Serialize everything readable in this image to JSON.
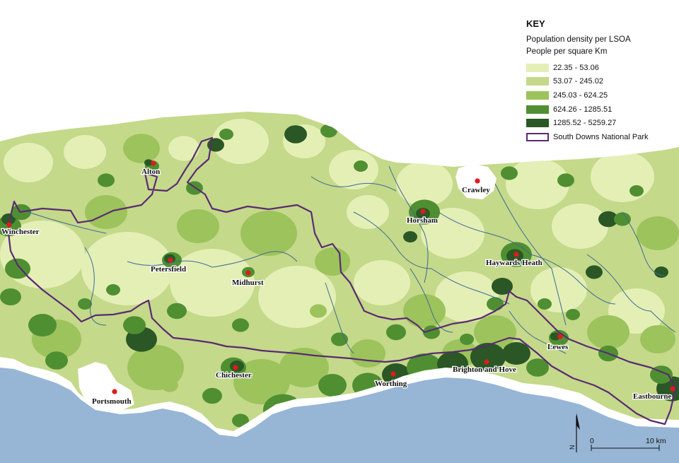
{
  "legend": {
    "title": "KEY",
    "subtitle_1": "Population density per LSOA",
    "subtitle_2": "People per square Km",
    "classes": [
      {
        "label": "22.35 - 53.06",
        "color": "#e4efb6"
      },
      {
        "label": "53.07 - 245.02",
        "color": "#c4d98a"
      },
      {
        "label": "245.03 - 624.25",
        "color": "#9dc35c"
      },
      {
        "label": "624.26 - 1285.51",
        "color": "#4f8f32"
      },
      {
        "label": "1285.52 - 5259.27",
        "color": "#2a5725"
      }
    ],
    "boundary_label": "South Downs National Park",
    "boundary_color": "#5a2a72"
  },
  "towns": [
    {
      "name": "Alton"
    },
    {
      "name": "Winchester"
    },
    {
      "name": "Petersfield"
    },
    {
      "name": "Midhurst"
    },
    {
      "name": "Chichester"
    },
    {
      "name": "Portsmouth"
    },
    {
      "name": "Worthing"
    },
    {
      "name": "Horsham"
    },
    {
      "name": "Crawley"
    },
    {
      "name": "Haywards Heath"
    },
    {
      "name": "Brighton and Hove"
    },
    {
      "name": "Lewes"
    },
    {
      "name": "Eastbourne"
    }
  ],
  "scale_bar": {
    "start_label": "0",
    "end_label": "10 km"
  },
  "north_arrow": {
    "label": "N"
  },
  "colors": {
    "sea": "#97b6d6",
    "river": "#3d6b92",
    "town_marker": "#e01b1b"
  }
}
